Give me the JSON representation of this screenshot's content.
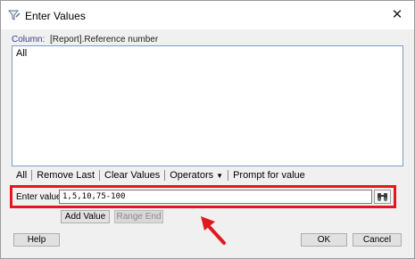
{
  "window": {
    "title": "Enter Values",
    "close_glyph": "✕"
  },
  "column": {
    "label": "Column:",
    "value": "[Report].Reference number"
  },
  "values_box": {
    "text": "All"
  },
  "toolbar": {
    "all": "All",
    "remove_last": "Remove Last",
    "clear_values": "Clear Values",
    "operators": "Operators",
    "prompt": "Prompt for value"
  },
  "enter": {
    "label": "Enter value:",
    "value": "1,5,10,75-100"
  },
  "buttons": {
    "add_value": "Add Value",
    "range_end": "Range End",
    "help": "Help",
    "ok": "OK",
    "cancel": "Cancel"
  },
  "colors": {
    "highlight": "#e0191e",
    "annotation_arrow": "#e0191e"
  },
  "icons": {
    "app": "funnel-edit-icon",
    "binoculars": "binoculars-icon",
    "operators_dropdown": "caret-down-icon"
  }
}
